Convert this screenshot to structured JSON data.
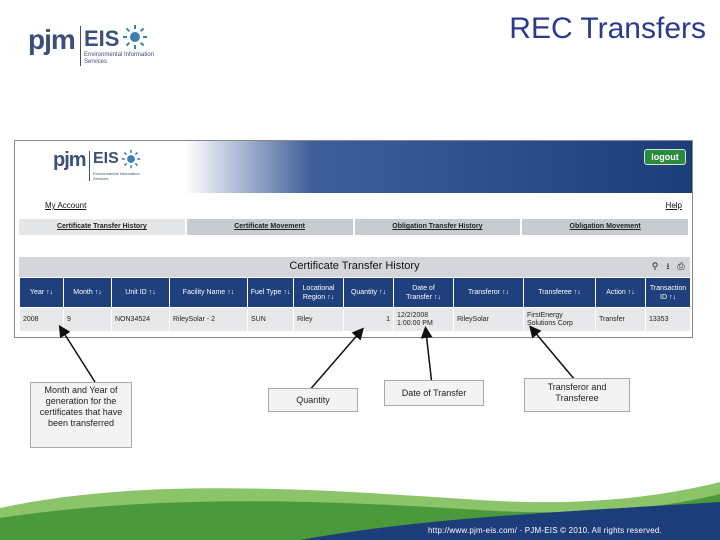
{
  "slide": {
    "title": "REC Transfers",
    "logo": {
      "pjm": "pjm",
      "eis": "EIS",
      "subtitle": "Environmental Information Services"
    },
    "footer": "http://www.pjm-eis.com/ · PJM-EIS © 2010. All rights reserved."
  },
  "app": {
    "logo": {
      "pjm": "pjm",
      "eis": "EIS",
      "subtitle": "Environmental Information Services"
    },
    "logout_label": "logout",
    "my_account": "My Account",
    "help": "Help",
    "tabs": [
      {
        "label": "Certificate Transfer History",
        "active": true
      },
      {
        "label": "Certificate Movement",
        "active": false
      },
      {
        "label": "Obligation Transfer History",
        "active": false
      },
      {
        "label": "Obligation Movement",
        "active": false
      }
    ],
    "table_title": "Certificate Transfer History",
    "tool_icons": [
      "search-icon",
      "download-icon",
      "print-icon"
    ],
    "columns": [
      "Year",
      "Month",
      "Unit ID",
      "Facility Name",
      "Fuel Type",
      "Locational Region",
      "Quantity",
      "Date of Transfer",
      "Transferor",
      "Transferee",
      "Action",
      "Transaction ID"
    ],
    "sort_glyph": "↑↓",
    "rows": [
      [
        "2008",
        "9",
        "NON34524",
        "RileySolar - 2",
        "SUN",
        "Riley",
        "1",
        "12/2/2008 1:00:00 PM",
        "RileySolar",
        "FirstEnergy Solutions Corp",
        "Transfer",
        "13353"
      ]
    ]
  },
  "callouts": {
    "month_year": "Month and Year of generation for the certificates that have been transferred",
    "quantity": "Quantity",
    "date": "Date of Transfer",
    "parties": "Transferor and Transferee"
  },
  "colors": {
    "title": "#2a3b8f",
    "header_bg": "#1f3f7d",
    "row_bg": "#e8e8ea",
    "logout_green": "#2b8a3e",
    "footer_green": "#4a9a3c",
    "footer_blue": "#1d3d7a"
  }
}
